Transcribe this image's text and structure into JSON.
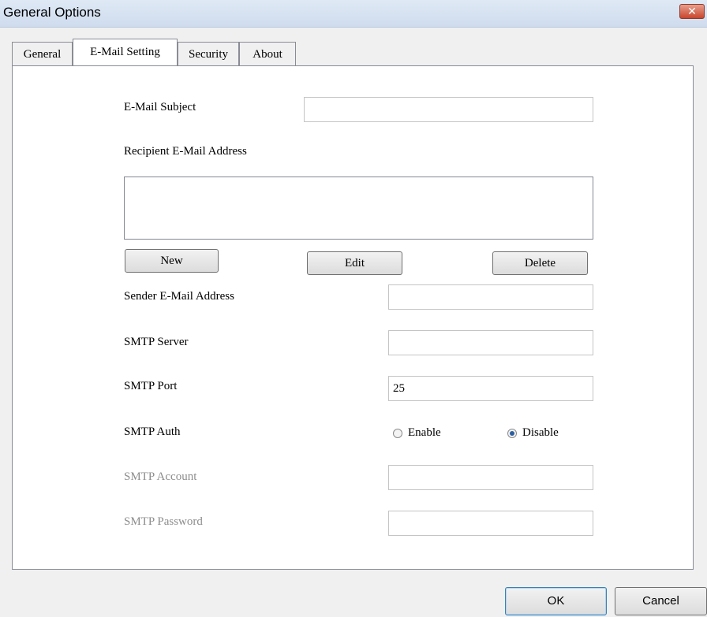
{
  "window": {
    "title": "General Options",
    "close_glyph": "✕"
  },
  "tabs": [
    {
      "label": "General"
    },
    {
      "label": "E-Mail Setting"
    },
    {
      "label": "Security"
    },
    {
      "label": "About"
    }
  ],
  "active_tab": "E-Mail Setting",
  "form": {
    "subject_label": "E-Mail Subject",
    "subject_value": "",
    "recipient_label": "Recipient E-Mail Address",
    "recipient_list": [],
    "new_label": "New",
    "edit_label": "Edit",
    "delete_label": "Delete",
    "sender_label": "Sender E-Mail Address",
    "sender_value": "",
    "server_label": "SMTP Server",
    "server_value": "",
    "port_label": "SMTP Port",
    "port_value": "25",
    "auth_label": "SMTP Auth",
    "auth_enable": "Enable",
    "auth_disable": "Disable",
    "auth_selected": "Disable",
    "account_label": "SMTP Account",
    "account_value": "",
    "password_label": "SMTP Password",
    "password_value": ""
  },
  "footer": {
    "ok_label": "OK",
    "cancel_label": "Cancel"
  }
}
